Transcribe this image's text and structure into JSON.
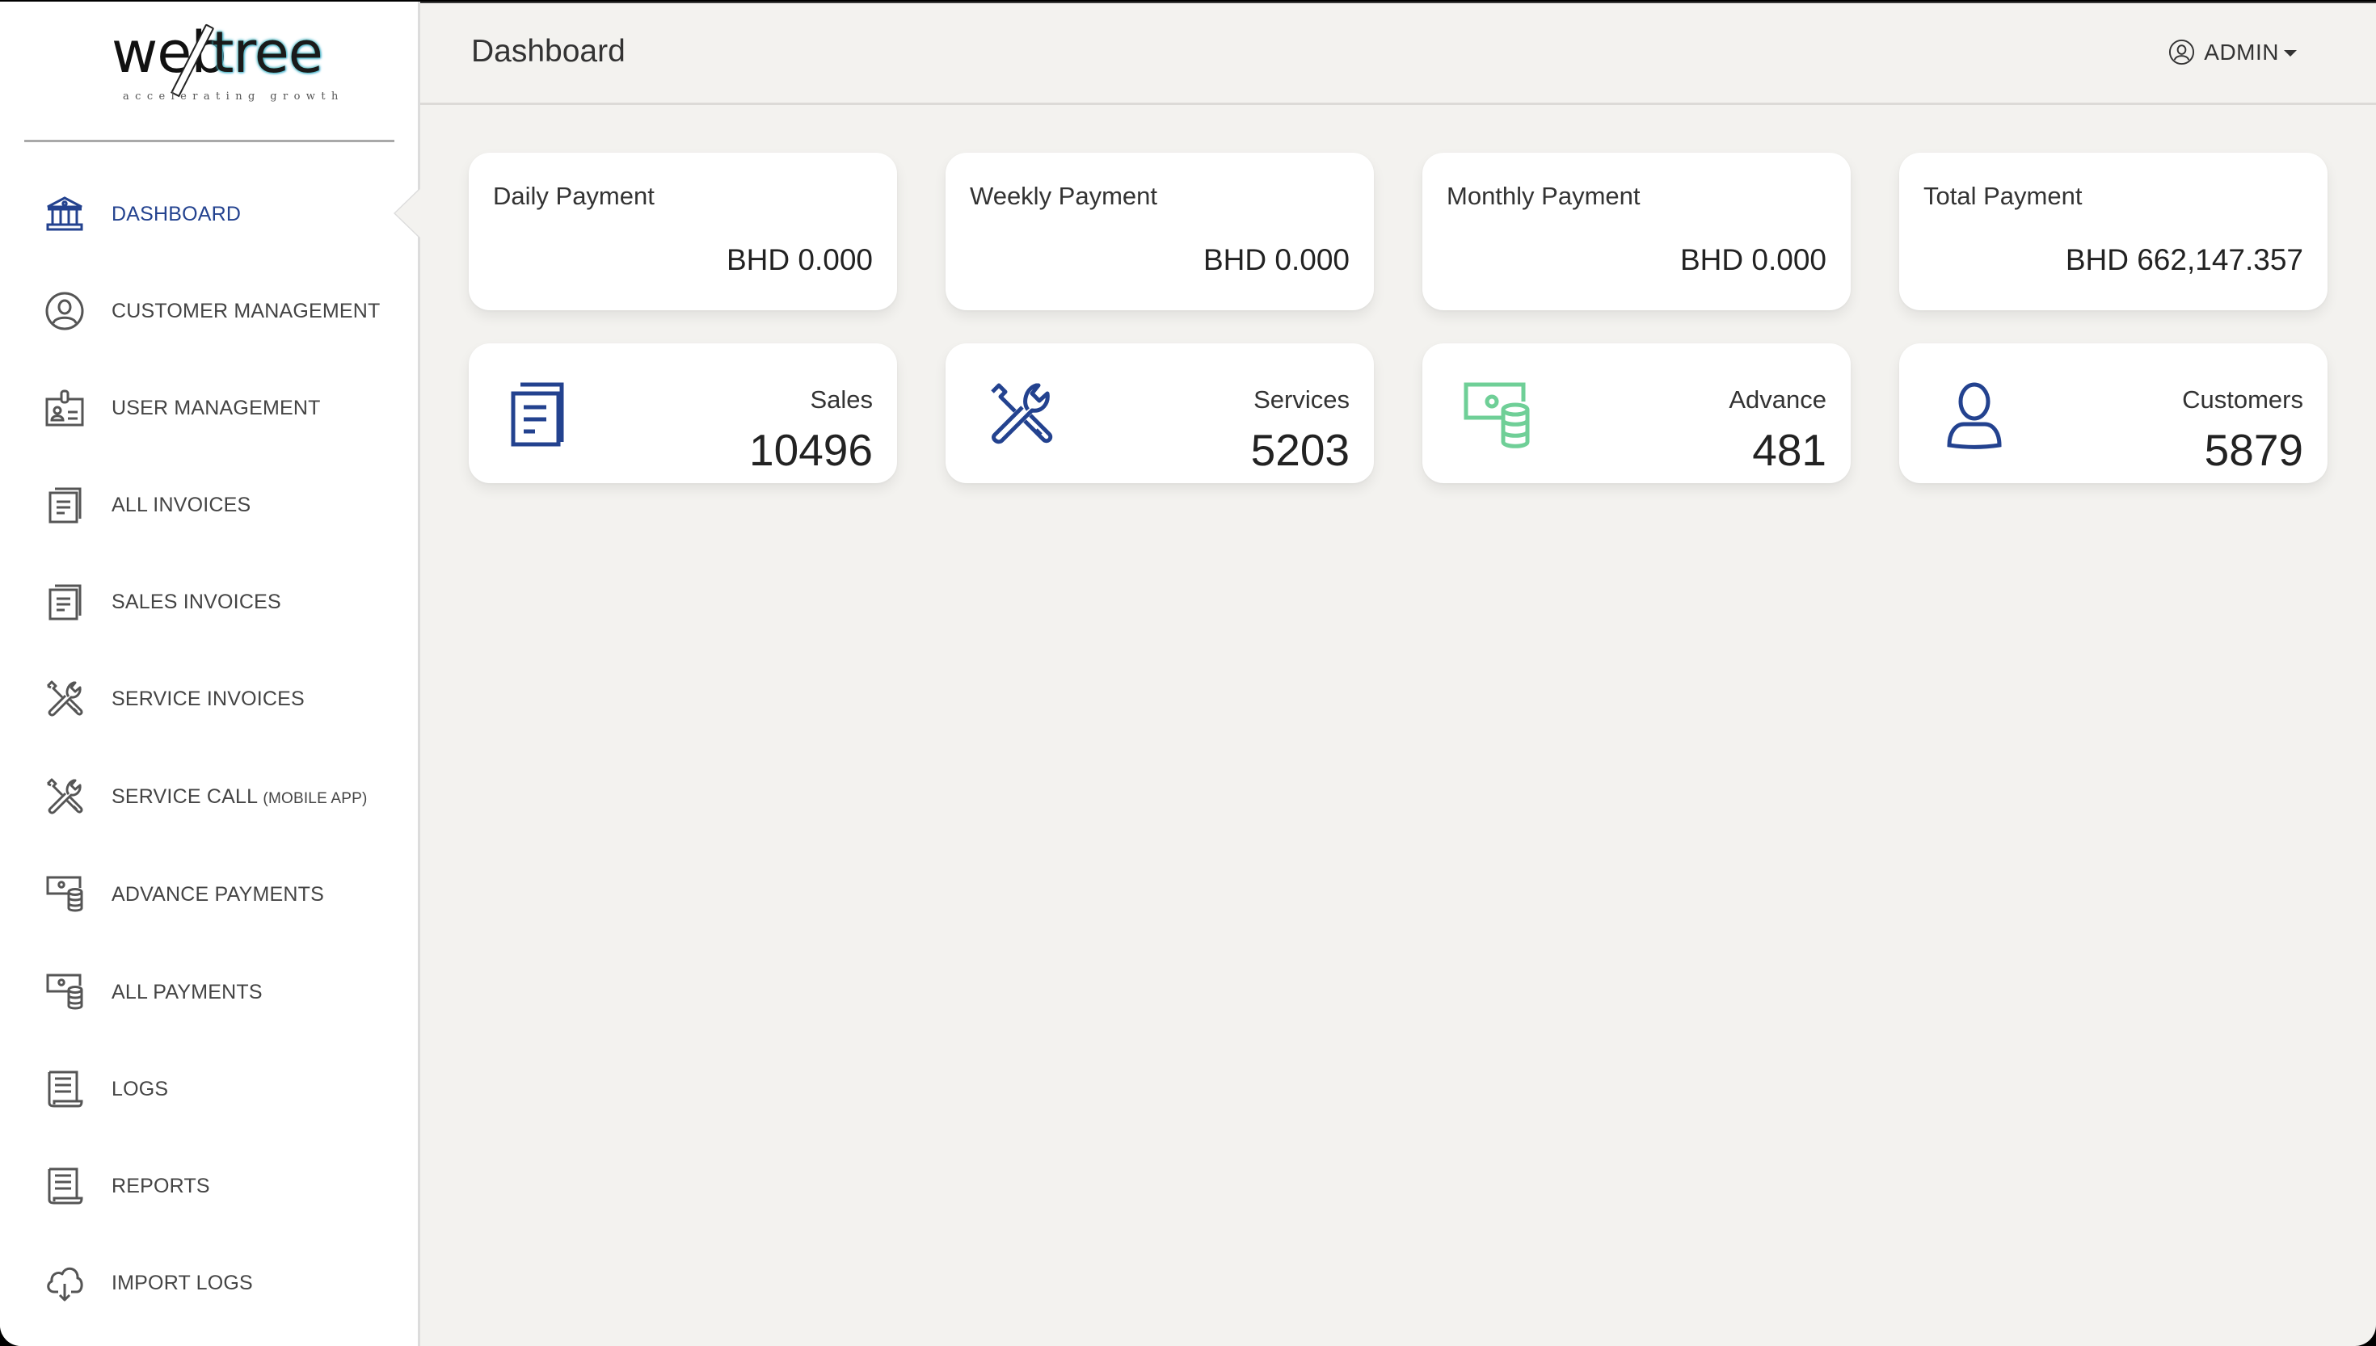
{
  "brand": {
    "word_left": "web",
    "word_right": "tree",
    "tagline": "accelerating growth"
  },
  "sidebar": {
    "items": [
      {
        "label": "Dashboard",
        "icon": "bank-icon",
        "active": true
      },
      {
        "label": "Customer Management",
        "icon": "user-circle-icon"
      },
      {
        "label": "User Management",
        "icon": "id-badge-icon"
      },
      {
        "label": "All Invoices",
        "icon": "documents-icon"
      },
      {
        "label": "Sales Invoices",
        "icon": "documents-icon"
      },
      {
        "label": "Service Invoices",
        "icon": "tools-icon"
      },
      {
        "label": "Service Call",
        "sublabel": "(Mobile App)",
        "icon": "tools-icon"
      },
      {
        "label": "Advance Payments",
        "icon": "money-coins-icon"
      },
      {
        "label": "All Payments",
        "icon": "money-coins-icon"
      },
      {
        "label": "Logs",
        "icon": "scroll-icon"
      },
      {
        "label": "Reports",
        "icon": "scroll-icon"
      },
      {
        "label": "Import Logs",
        "icon": "cloud-download-icon"
      }
    ]
  },
  "header": {
    "title": "Dashboard",
    "user": "ADMIN"
  },
  "payments": [
    {
      "title": "Daily Payment",
      "value": "BHD 0.000"
    },
    {
      "title": "Weekly Payment",
      "value": "BHD 0.000"
    },
    {
      "title": "Monthly Payment",
      "value": "BHD 0.000"
    },
    {
      "title": "Total Payment",
      "value": "BHD 662,147.357"
    }
  ],
  "stats": [
    {
      "label": "Sales",
      "value": "10496",
      "icon": "documents-icon",
      "color": "#23428f"
    },
    {
      "label": "Services",
      "value": "5203",
      "icon": "tools-icon",
      "color": "#23428f"
    },
    {
      "label": "Advance",
      "value": "481",
      "icon": "money-coins-icon",
      "color": "#6fcf97"
    },
    {
      "label": "Customers",
      "value": "5879",
      "icon": "user-icon",
      "color": "#23428f"
    }
  ],
  "colors": {
    "accent": "#23428f",
    "advance_icon": "#6fcf97",
    "nav_text": "#444444",
    "background": "#f3f2ef"
  }
}
